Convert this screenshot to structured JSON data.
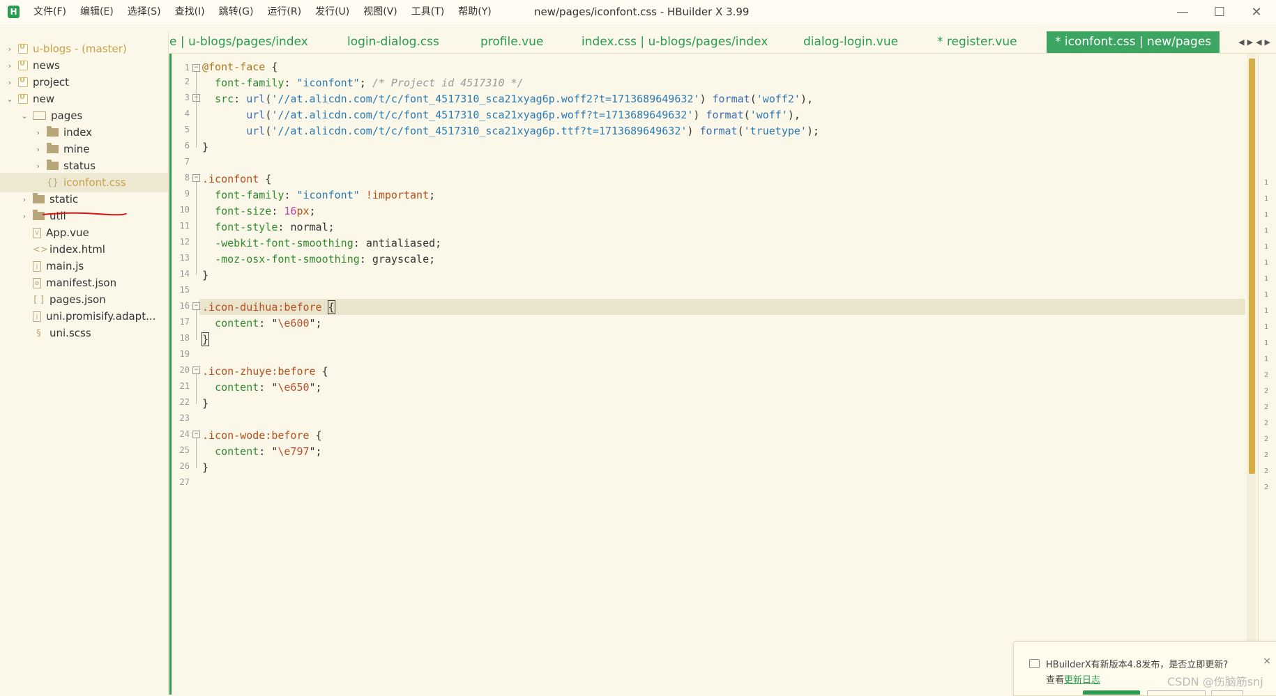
{
  "window": {
    "title": "new/pages/iconfont.css - HBuilder X 3.99",
    "logo_letter": "H",
    "minimize_icon": "—",
    "maximize_icon": "☐",
    "close_icon": "✕"
  },
  "menu": [
    "文件(F)",
    "编辑(E)",
    "选择(S)",
    "查找(I)",
    "跳转(G)",
    "运行(R)",
    "发行(U)",
    "视图(V)",
    "工具(T)",
    "帮助(Y)"
  ],
  "sidebar": {
    "items": [
      {
        "label": "u-blogs - (master)",
        "icon": "project-icon",
        "expanded": false,
        "depth": 0
      },
      {
        "label": "news",
        "icon": "project-icon",
        "expanded": false,
        "depth": 0
      },
      {
        "label": "project",
        "icon": "project-icon",
        "expanded": false,
        "depth": 0
      },
      {
        "label": "new",
        "icon": "project-icon",
        "expanded": true,
        "depth": 0
      },
      {
        "label": "pages",
        "icon": "folder-open-icon",
        "expanded": true,
        "depth": 1
      },
      {
        "label": "index",
        "icon": "folder-icon",
        "expanded": false,
        "depth": 2
      },
      {
        "label": "mine",
        "icon": "folder-icon",
        "expanded": false,
        "depth": 2
      },
      {
        "label": "status",
        "icon": "folder-icon",
        "expanded": false,
        "depth": 2
      },
      {
        "label": "iconfont.css",
        "icon": "css-file-icon",
        "selected": true,
        "depth": 2
      },
      {
        "label": "static",
        "icon": "folder-icon",
        "expanded": false,
        "depth": 1
      },
      {
        "label": "util",
        "icon": "folder-icon",
        "expanded": false,
        "depth": 1
      },
      {
        "label": "App.vue",
        "icon": "vue-file-icon",
        "depth": 1
      },
      {
        "label": "index.html",
        "icon": "html-file-icon",
        "depth": 1
      },
      {
        "label": "main.js",
        "icon": "js-file-icon",
        "depth": 1
      },
      {
        "label": "manifest.json",
        "icon": "manifest-file-icon",
        "depth": 1
      },
      {
        "label": "pages.json",
        "icon": "json-file-icon",
        "depth": 1
      },
      {
        "label": "uni.promisify.adapt...",
        "icon": "js-file-icon",
        "depth": 1
      },
      {
        "label": "uni.scss",
        "icon": "scss-file-icon",
        "depth": 1
      }
    ]
  },
  "tabs": [
    {
      "label": "e | u-blogs/pages/index"
    },
    {
      "label": "login-dialog.css"
    },
    {
      "label": "profile.vue"
    },
    {
      "label": "index.css | u-blogs/pages/index"
    },
    {
      "label": "dialog-login.vue"
    },
    {
      "label": "* register.vue"
    },
    {
      "label": "* iconfont.css | new/pages",
      "active": true
    }
  ],
  "tab_nav": "◀▶◀▶",
  "editor": {
    "line_numbers": [
      "1",
      "2",
      "3",
      "4",
      "5",
      "6",
      "7",
      "8",
      "9",
      "10",
      "11",
      "12",
      "13",
      "14",
      "15",
      "16",
      "17",
      "18",
      "19",
      "20",
      "21",
      "22",
      "23",
      "24",
      "25",
      "26",
      "27"
    ],
    "lines": {
      "l1_at": "@font-face",
      "l1_rest": " {",
      "l2_prop": "font-family",
      "l2_val": "\"iconfont\"",
      "l2_cmt": "/* Project id 4517310 */",
      "l3_prop": "src",
      "l3_url": "'//at.alicdn.com/t/c/font_4517310_sca21xyag6p.woff2?t=1713689649632'",
      "l3_fmt": "'woff2'",
      "l4_url": "'//at.alicdn.com/t/c/font_4517310_sca21xyag6p.woff?t=1713689649632'",
      "l4_fmt": "'woff'",
      "l5_url": "'//at.alicdn.com/t/c/font_4517310_sca21xyag6p.ttf?t=1713689649632'",
      "l5_fmt": "'truetype'",
      "close": "}",
      "l8_sel": ".iconfont",
      "l9_prop": "font-family",
      "l9_val": "\"iconfont\"",
      "l9_imp": "!important",
      "l10_prop": "font-size",
      "l10_num": "16",
      "l10_unit": "px",
      "l11_prop": "font-style",
      "l11_val": "normal",
      "l12_prop": "-webkit-font-smoothing",
      "l12_val": "antialiased",
      "l13_prop": "-moz-osx-font-smoothing",
      "l13_val": "grayscale",
      "l16_sel": ".icon-duihua:before",
      "l17_prop": "content",
      "l17_val": "\\e600",
      "l20_sel": ".icon-zhuye:before",
      "l21_prop": "content",
      "l21_val": "\\e650",
      "l24_sel": ".icon-wode:before",
      "l25_prop": "content",
      "l25_val": "\\e797",
      "kw_url": "url",
      "kw_format": "format"
    }
  },
  "minimap_numbers": [
    "1",
    "1",
    "1",
    "1",
    "1",
    "1",
    "1",
    "1",
    "1",
    "1",
    "1",
    "1",
    "2",
    "2",
    "2",
    "2",
    "2",
    "2",
    "2",
    "2"
  ],
  "notification": {
    "message": "HBuilderX有新版本4.8发布，是否立即更新?",
    "prefix": "查看",
    "link": "更新日志",
    "close": "×"
  },
  "watermark": "CSDN @伤脑筋snj",
  "colors": {
    "accent": "#2a9c50",
    "background": "#fbf8ea",
    "scroll_thumb": "#d4ae45"
  }
}
